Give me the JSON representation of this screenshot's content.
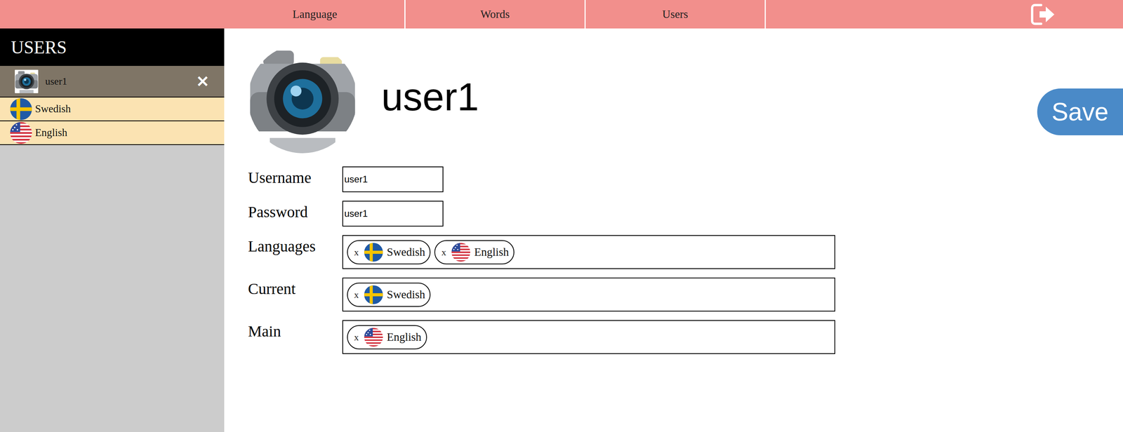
{
  "nav": {
    "tabs": [
      {
        "label": "Language"
      },
      {
        "label": "Words"
      },
      {
        "label": "Users"
      }
    ]
  },
  "sidebar": {
    "title": "USERS",
    "users": [
      {
        "name": "user1",
        "selected": true,
        "remove": "✕",
        "languages": [
          {
            "name": "Swedish",
            "kind": "sweden"
          },
          {
            "name": "English",
            "kind": "usa"
          }
        ]
      }
    ]
  },
  "profile": {
    "name": "user1",
    "save": "Save",
    "fields": [
      {
        "label": "Username",
        "value": "user1"
      },
      {
        "label": "Password",
        "value": "user1"
      }
    ],
    "tag_fields": [
      {
        "label": "Languages",
        "tags": [
          {
            "remove": "x",
            "name": "Swedish",
            "kind": "sweden"
          },
          {
            "remove": "x",
            "name": "English",
            "kind": "usa"
          }
        ]
      },
      {
        "label": "Current",
        "tags": [
          {
            "remove": "x",
            "name": "Swedish",
            "kind": "sweden"
          }
        ]
      },
      {
        "label": "Main",
        "tags": [
          {
            "remove": "x",
            "name": "English",
            "kind": "usa"
          }
        ]
      }
    ]
  }
}
